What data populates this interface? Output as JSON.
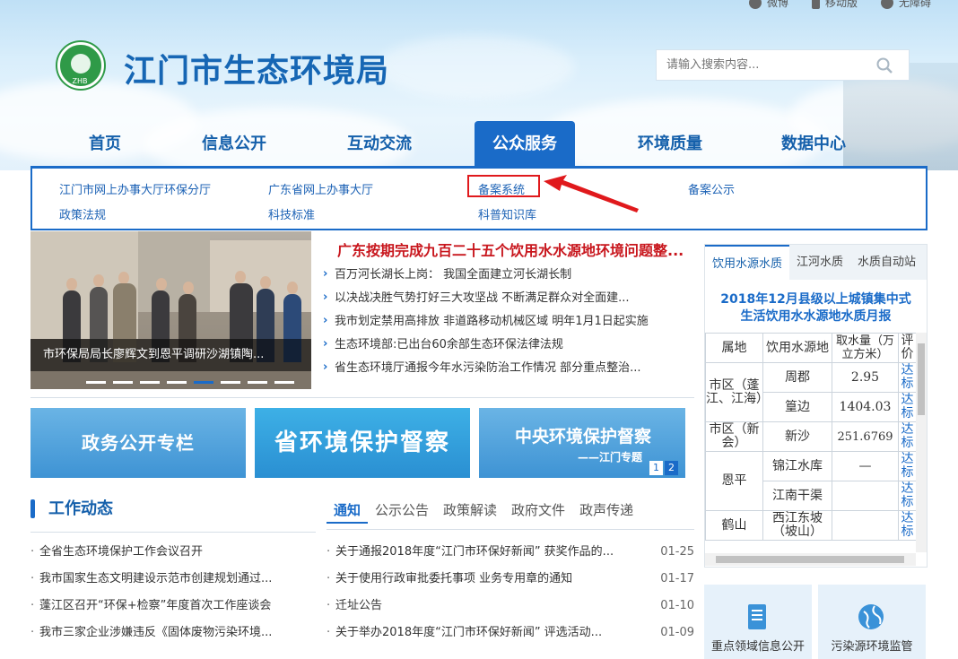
{
  "top_links": [
    "微博",
    "移动版",
    "无障碍"
  ],
  "site": {
    "title": "江门市生态环境局",
    "logo_text": "ZHB"
  },
  "search": {
    "placeholder": "请输入搜索内容..."
  },
  "nav": [
    "首页",
    "信息公开",
    "互动交流",
    "公众服务",
    "环境质量",
    "数据中心"
  ],
  "nav_active": "公众服务",
  "submenu": {
    "row1": [
      "江门市网上办事大厅环保分厅",
      "广东省网上办事大厅",
      "备案系统",
      "备案公示"
    ],
    "row2": [
      "政策法规",
      "科技标准",
      "科普知识库"
    ],
    "highlighted": "备案系统"
  },
  "slider": {
    "caption": "市环保局局长廖辉文到恩平调研沙湖镇陶...",
    "dot_count": 8,
    "active_dot": 5
  },
  "headline": "广东按期完成九百二十五个饮用水水源地环境问题整...",
  "news": [
    "百万河长湖长上岗： 我国全面建立河长湖长制",
    "以决战决胜气势打好三大攻坚战 不断满足群众对全面建...",
    "我市划定禁用高排放 非道路移动机械区域 明年1月1日起实施",
    "生态环境部:已出台60余部生态环保法律法规",
    "省生态环境厅通报今年水污染防治工作情况 部分重点整治..."
  ],
  "banners": {
    "b1": "政务公开专栏",
    "b2": "省环境保护督察",
    "b3_line1": "中央环境保护督察",
    "b3_line2": "——江门专题",
    "pages": [
      "1",
      "2"
    ]
  },
  "work": {
    "title": "工作动态",
    "items": [
      "全省生态环境保护工作会议召开",
      "我市国家生态文明建设示范市创建规划通过...",
      "蓬江区召开“环保+检察”年度首次工作座谈会",
      "我市三家企业涉嫌违反《固体废物污染环境..."
    ]
  },
  "notice_tabs": [
    "通知",
    "公示公告",
    "政策解读",
    "政府文件",
    "政声传递"
  ],
  "notices": [
    {
      "text": "关于通报2018年度“江门市环保好新闻” 获奖作品的...",
      "date": "01-25"
    },
    {
      "text": "关于使用行政审批委托事项 业务专用章的通知",
      "date": "01-17"
    },
    {
      "text": "迁址公告",
      "date": "01-10"
    },
    {
      "text": "关于举办2018年度“江门市环保好新闻” 评选活动...",
      "date": "01-09"
    }
  ],
  "water": {
    "tabs": [
      "饮用水源水质",
      "江河水质",
      "水质自动站"
    ],
    "title_line1": "2018年12月县级以上城镇集中式",
    "title_line2": "生活饮用水水源地水质月报",
    "headers": [
      "属地",
      "饮用水源地",
      "取水量（万立方米）",
      "评价"
    ],
    "rows": [
      {
        "area": "市区（蓬江、江海）",
        "source": "周郡",
        "volume": "2.95",
        "eval": "达标"
      },
      {
        "source": "篁边",
        "volume": "1404.03",
        "eval": "达标"
      },
      {
        "area": "市区（新会）",
        "source": "新沙",
        "volume": "251.6769",
        "eval": "达标"
      },
      {
        "area": "恩平",
        "source": "锦江水库",
        "volume": "—",
        "eval": "达标"
      },
      {
        "source": "江南干渠",
        "volume": "",
        "eval": "达标"
      },
      {
        "area": "鹤山",
        "source": "西江东坡（坡山）",
        "volume": "",
        "eval": "达标"
      }
    ]
  },
  "quick": [
    "重点领域信息公开",
    "污染源环境监管"
  ],
  "colors": {
    "brand": "#1a6bc8",
    "headline": "#c8161d",
    "highlight": "#e0191c"
  }
}
